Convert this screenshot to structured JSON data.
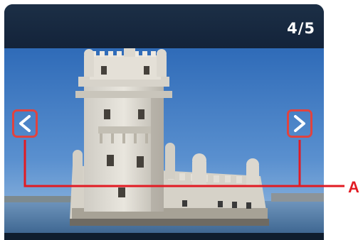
{
  "viewer": {
    "page_counter": "4/5",
    "photo": {
      "subject": "tower-fortress-photo"
    },
    "nav": {
      "previous_icon": "chevron-left-icon",
      "next_icon": "chevron-right-icon"
    }
  },
  "callout": {
    "label": "A",
    "color": "#e21b23"
  }
}
